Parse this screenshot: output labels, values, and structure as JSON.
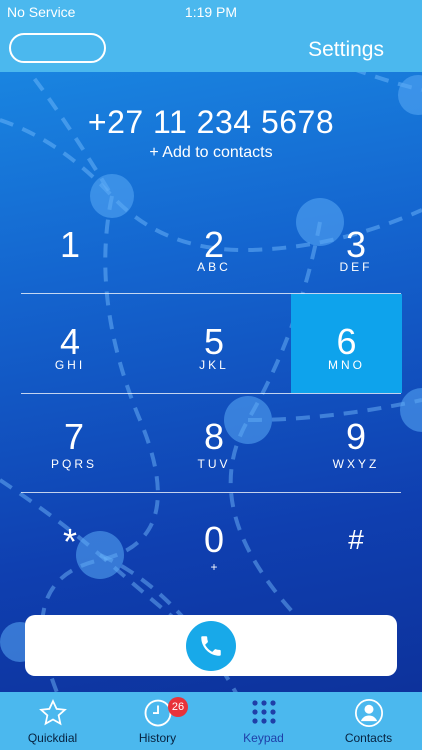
{
  "status_bar": {
    "carrier": "No Service",
    "time": "1:19 PM"
  },
  "header": {
    "settings_label": "Settings"
  },
  "dialer": {
    "number": "+27 11 234 5678",
    "add_to_contacts": "+ Add to contacts"
  },
  "keys": [
    {
      "digit": "1",
      "letters": ""
    },
    {
      "digit": "2",
      "letters": "ABC"
    },
    {
      "digit": "3",
      "letters": "DEF"
    },
    {
      "digit": "4",
      "letters": "GHI"
    },
    {
      "digit": "5",
      "letters": "JKL"
    },
    {
      "digit": "6",
      "letters": "MNO"
    },
    {
      "digit": "7",
      "letters": "PQRS"
    },
    {
      "digit": "8",
      "letters": "TUV"
    },
    {
      "digit": "9",
      "letters": "WXYZ"
    },
    {
      "digit": "*",
      "letters": ""
    },
    {
      "digit": "0",
      "letters": "+"
    },
    {
      "digit": "#",
      "letters": ""
    }
  ],
  "call_button": {
    "icon": "phone-icon"
  },
  "tab_bar": {
    "tabs": [
      {
        "label": "Quickdial",
        "icon": "star-icon"
      },
      {
        "label": "History",
        "icon": "clock-icon",
        "badge": "26"
      },
      {
        "label": "Keypad",
        "icon": "keypad-grid-icon",
        "selected": true
      },
      {
        "label": "Contacts",
        "icon": "contact-person-icon"
      }
    ]
  },
  "colors": {
    "header": "#4bb8ee",
    "active_key": "#0ea3ec",
    "badge": "#e8323a",
    "call": "#18a9e9"
  }
}
